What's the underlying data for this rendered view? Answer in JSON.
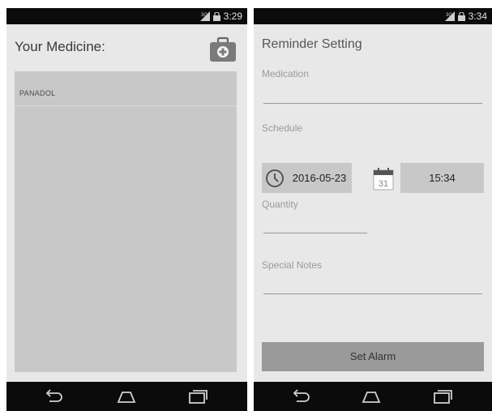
{
  "left": {
    "status_time": "3:29",
    "title": "Your Medicine:",
    "medicines": [
      "PANADOL"
    ]
  },
  "right": {
    "status_time": "3:34",
    "title": "Reminder Setting",
    "medication_label": "Medication",
    "medication_value": "",
    "schedule_label": "Schedule",
    "date": "2016-05-23",
    "calendar_day": "31",
    "time": "15:34",
    "quantity_label": "Quantity",
    "quantity_value": "",
    "notes_label": "Special Notes",
    "notes_value": "",
    "set_alarm_label": "Set Alarm"
  },
  "icons": {
    "signal": "signal-icon",
    "lock": "lock-icon",
    "back": "back-icon",
    "home": "home-icon",
    "recents": "recents-icon",
    "medkit": "medical-kit-icon",
    "clock": "clock-icon",
    "calendar": "calendar-icon"
  },
  "colors": {
    "status_bar": "#0b0b0b",
    "screen_bg": "#e8e8e8",
    "panel": "#c8c8c8",
    "button": "#9a9a9a"
  }
}
